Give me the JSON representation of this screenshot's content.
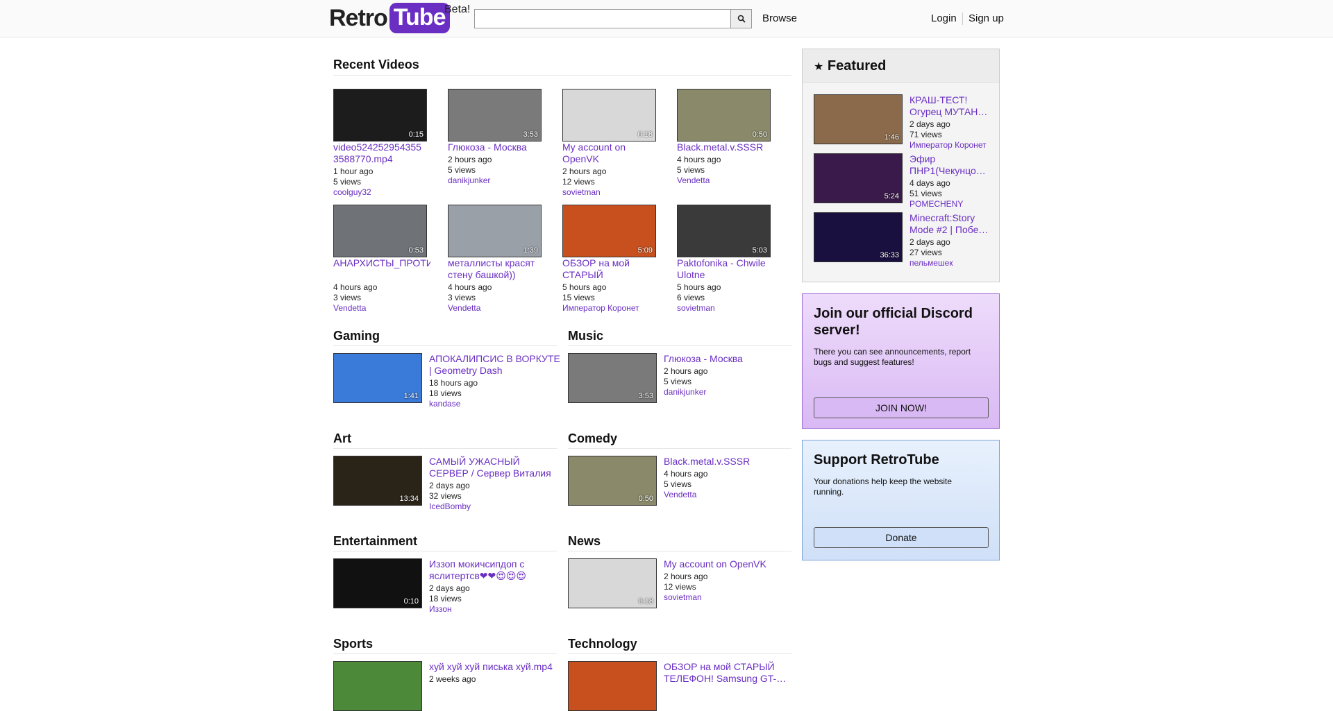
{
  "header": {
    "logo_left": "Retro",
    "logo_right": "Tube",
    "beta": "Beta!",
    "search_placeholder": "",
    "browse": "Browse",
    "login": "Login",
    "signup": "Sign up"
  },
  "recent": {
    "title": "Recent Videos",
    "videos": [
      {
        "title": "video524252954355 3588770.mp4",
        "time": "1 hour ago",
        "views": "5 views",
        "user": "coolguy32",
        "duration": "0:15",
        "color": "#1c1c1c"
      },
      {
        "title": "Глюкоза - Москва",
        "time": "2 hours ago",
        "views": "5 views",
        "user": "danikjunker",
        "duration": "3:53",
        "color": "#7a7a7a"
      },
      {
        "title": "My account on OpenVK",
        "time": "2 hours ago",
        "views": "12 views",
        "user": "sovietman",
        "duration": "0:18",
        "color": "#d8d8d8"
      },
      {
        "title": "Black.metal.v.SSSR",
        "time": "4 hours ago",
        "views": "5 views",
        "user": "Vendetta",
        "duration": "0:50",
        "color": "#8a8a6a"
      },
      {
        "title": "АНАРХИСТЫ_ПРОТИВ_РЕПЕРОВ",
        "time": "4 hours ago",
        "views": "3 views",
        "user": "Vendetta",
        "duration": "0:53",
        "color": "#6f7378"
      },
      {
        "title": "металлисты красят стену башкой))",
        "time": "4 hours ago",
        "views": "3 views",
        "user": "Vendetta",
        "duration": "1:39",
        "color": "#9aa0a8"
      },
      {
        "title": "ОБЗОР на мой СТАРЫЙ ТЕЛЕФОН…",
        "time": "5 hours ago",
        "views": "15 views",
        "user": "Император Коронет",
        "duration": "5:09",
        "color": "#c8501e"
      },
      {
        "title": "Paktofonika - Chwile Ulotne",
        "time": "5 hours ago",
        "views": "6 views",
        "user": "sovietman",
        "duration": "5:03",
        "color": "#3a3a3a"
      }
    ]
  },
  "categories": [
    {
      "title": "Gaming",
      "video": {
        "title": "АПОКАЛИПСИС В ВОРКУТЕ | Geometry Dash",
        "time": "18 hours ago",
        "views": "18 views",
        "user": "kandase",
        "duration": "1:41",
        "color": "#3a7ad8"
      }
    },
    {
      "title": "Music",
      "video": {
        "title": "Глюкоза - Москва",
        "time": "2 hours ago",
        "views": "5 views",
        "user": "danikjunker",
        "duration": "3:53",
        "color": "#7a7a7a"
      }
    },
    {
      "title": "Art",
      "video": {
        "title": "САМЫЙ УЖАСНЫЙ СЕРВЕР / Сервер Виталия",
        "time": "2 days ago",
        "views": "32 views",
        "user": "IcedBomby",
        "duration": "13:34",
        "color": "#2a2418"
      }
    },
    {
      "title": "Comedy",
      "video": {
        "title": "Black.metal.v.SSSR",
        "time": "4 hours ago",
        "views": "5 views",
        "user": "Vendetta",
        "duration": "0:50",
        "color": "#8a8a6a"
      }
    },
    {
      "title": "Entertainment",
      "video": {
        "title": "Иззоп мокичсипдоп с яслитертсв❤❤😍😍😍",
        "time": "2 days ago",
        "views": "18 views",
        "user": "Иззон",
        "duration": "0:10",
        "color": "#111111"
      }
    },
    {
      "title": "News",
      "video": {
        "title": "My account on OpenVK",
        "time": "2 hours ago",
        "views": "12 views",
        "user": "sovietman",
        "duration": "0:18",
        "color": "#d8d8d8"
      }
    },
    {
      "title": "Sports",
      "video": {
        "title": "хуй хуй хуй писька хуй.mp4",
        "time": "2 weeks ago",
        "views": "",
        "user": "",
        "duration": "",
        "color": "#4c8a3a"
      }
    },
    {
      "title": "Technology",
      "video": {
        "title": "ОБЗОР на мой СТАРЫЙ ТЕЛЕФОН! Samsung GT-…",
        "time": "",
        "views": "",
        "user": "",
        "duration": "",
        "color": "#c8501e"
      }
    }
  ],
  "featured": {
    "title": "Featured",
    "videos": [
      {
        "title": "КРАШ-ТЕСТ! Огурец МУТАН…",
        "time": "2 days ago",
        "views": "71 views",
        "user": "Император Коронет",
        "duration": "1:46",
        "color": "#8a6a4a"
      },
      {
        "title": "Эфир ПНР1(Чекунцо…",
        "time": "4 days ago",
        "views": "51 views",
        "user": "POMECHENY",
        "duration": "5:24",
        "color": "#3a1a4a"
      },
      {
        "title": "Minecraft:Story Mode #2 | Побе…",
        "time": "2 days ago",
        "views": "27 views",
        "user": "пельмешек",
        "duration": "36:33",
        "color": "#1a1040"
      }
    ]
  },
  "discord": {
    "title": "Join our official Discord server!",
    "text": "There you can see announcements, report bugs and suggest features!",
    "button": "JOIN NOW!"
  },
  "support": {
    "title": "Support RetroTube",
    "text": "Your donations help keep the website running.",
    "button": "Donate"
  }
}
